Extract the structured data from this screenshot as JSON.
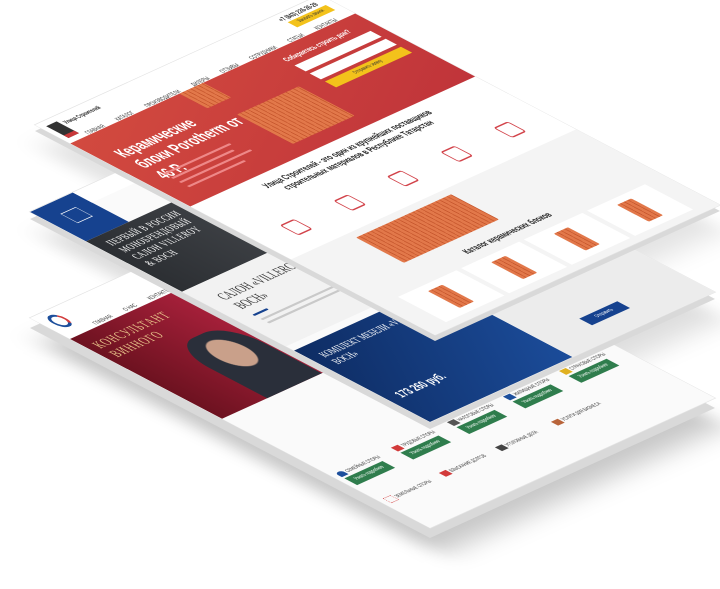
{
  "page_top": {
    "logo_name": "Улица Строителей",
    "phone": "+7 (843) 226-26-29",
    "callback_button": "Заказать звонок",
    "nav": [
      "Главная",
      "Каталог",
      "Производители",
      "Дилеры",
      "Отзывы",
      "Сотрудники",
      "Статьи",
      "Контакты"
    ],
    "hero_title": "Керамические блоки Porotherm от 46 Р.",
    "form_title": "Собираетесь строить дом?",
    "form_submit": "Отправить заявку",
    "about_title": "Улица Строителей - это один из крупнейших поставщиков строительных материалов в Республике Татарстан",
    "catalog_title": "Каталог керамических блоков",
    "brand_color": "#c8383a",
    "accent_color": "#f3c21b"
  },
  "page_middle": {
    "hero_title": "Первый в России монобрендовый салон Villeroy & Boch",
    "salon_title": "Салон «Villeroy & Boch»",
    "product_title": "Комплект мебели «Villeroy & Boch»",
    "price": "173 260 руб.",
    "send_button": "Отправить",
    "brand_color": "#16428f"
  },
  "page_bottom": {
    "hero_title": "Консультант винного",
    "nav": [
      "Главная",
      "О нас",
      "Контакты"
    ],
    "services": [
      "Семейные споры",
      "Трудовые споры",
      "Налоговые споры",
      "Жилищные споры",
      "Страховые споры",
      "Земельные споры",
      "Взыскание долгов",
      "Уголовные дела",
      "Услуги для бизнеса"
    ],
    "service_button": "Узнать подробнее",
    "brand_color": "#8e1b2c",
    "button_color": "#2f7d4d"
  }
}
